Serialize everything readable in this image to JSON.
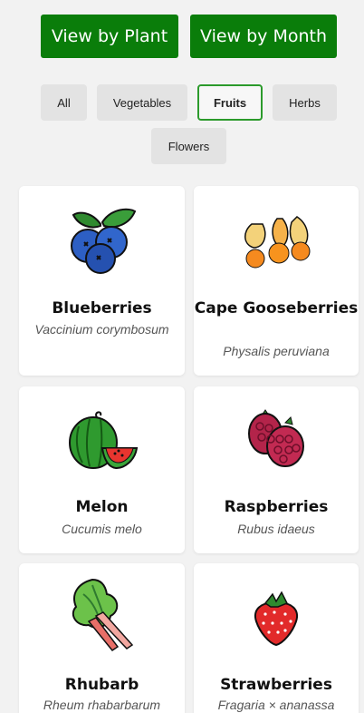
{
  "view_buttons": {
    "by_plant": "View by Plant",
    "by_month": "View by Month"
  },
  "filters": [
    {
      "label": "All",
      "active": false
    },
    {
      "label": "Vegetables",
      "active": false
    },
    {
      "label": "Fruits",
      "active": true
    },
    {
      "label": "Herbs",
      "active": false
    },
    {
      "label": "Flowers",
      "active": false
    }
  ],
  "plants": [
    {
      "name": "Blueberries",
      "latin": "Vaccinium corymbosum",
      "icon": "blueberries-icon"
    },
    {
      "name": "Cape Gooseberries",
      "latin": "Physalis peruviana",
      "icon": "cape-gooseberries-icon"
    },
    {
      "name": "Melon",
      "latin": "Cucumis melo",
      "icon": "melon-icon"
    },
    {
      "name": "Raspberries",
      "latin": "Rubus idaeus",
      "icon": "raspberries-icon"
    },
    {
      "name": "Rhubarb",
      "latin": "Rheum rhabarbarum",
      "icon": "rhubarb-icon"
    },
    {
      "name": "Strawberries",
      "latin": "Fragaria × ananassa",
      "icon": "strawberries-icon"
    }
  ],
  "colors": {
    "primary_green": "#0a7d0a",
    "active_border": "#2b9a2b"
  }
}
